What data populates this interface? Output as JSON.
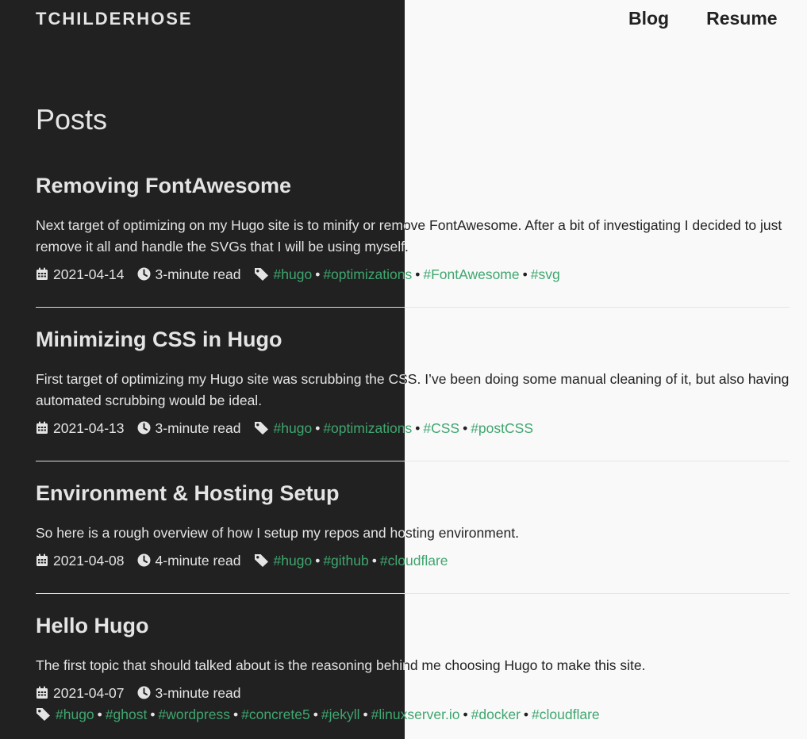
{
  "site": {
    "title": "TCHILDERHOSE"
  },
  "nav": {
    "blog": "Blog",
    "resume": "Resume"
  },
  "page": {
    "title": "Posts"
  },
  "posts": [
    {
      "title": "Removing FontAwesome",
      "summary": "Next target of optimizing on my Hugo site is to minify or remove FontAwesome. After a bit of investigating I decided to just remove it all and handle the SVGs that I will be using myself.",
      "date": "2021-04-14",
      "read_time": "3-minute read",
      "tags": [
        "#hugo",
        "#optimizations",
        "#FontAwesome",
        "#svg"
      ]
    },
    {
      "title": "Minimizing CSS in Hugo",
      "summary": "First target of optimizing my Hugo site was scrubbing the CSS. I’ve been doing some manual cleaning of it, but also having automated scrubbing would be ideal.",
      "date": "2021-04-13",
      "read_time": "3-minute read",
      "tags": [
        "#hugo",
        "#optimizations",
        "#CSS",
        "#postCSS"
      ]
    },
    {
      "title": "Environment & Hosting Setup",
      "summary": "So here is a rough overview of how I setup my repos and hosting environment.",
      "date": "2021-04-08",
      "read_time": "4-minute read",
      "tags": [
        "#hugo",
        "#github",
        "#cloudflare"
      ]
    },
    {
      "title": "Hello Hugo",
      "summary": "The first topic that should talked about is the reasoning behind me choosing Hugo to make this site.",
      "date": "2021-04-07",
      "read_time": "3-minute read",
      "tags": [
        "#hugo",
        "#ghost",
        "#wordpress",
        "#concrete5",
        "#jekyll",
        "#linuxserver.io",
        "#docker",
        "#cloudflare"
      ]
    }
  ],
  "colors": {
    "dark_bg": "#212121",
    "light_bg": "#f9f9f9",
    "tag": "#3fa66f"
  },
  "icons": {
    "date": "calendar-icon",
    "read_time": "clock-icon",
    "tags": "tag-icon"
  }
}
